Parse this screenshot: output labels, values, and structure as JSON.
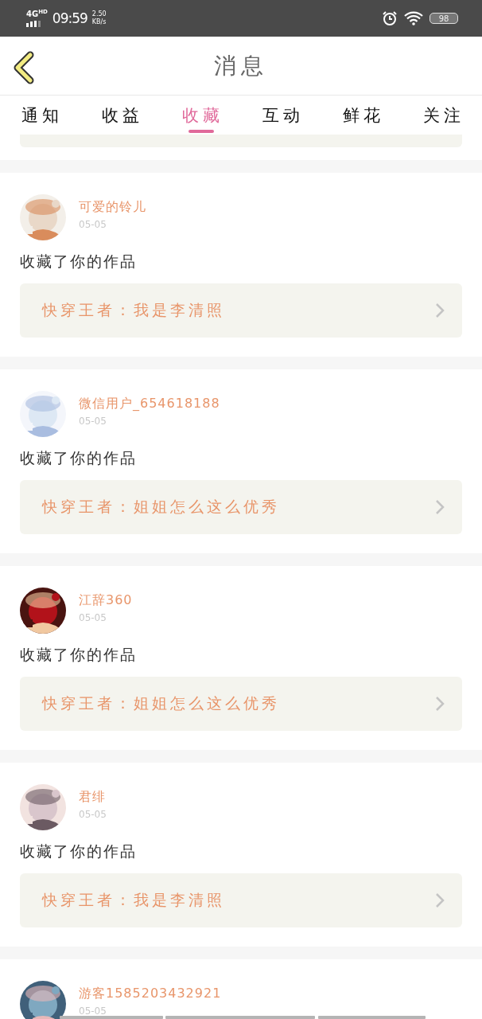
{
  "status_bar": {
    "network": "4G",
    "network_badge": "HD",
    "time": "09:59",
    "speed": "2.50",
    "speed_unit": "KB/s",
    "battery": "98"
  },
  "header": {
    "title": "消息"
  },
  "tabs": [
    {
      "label": "通知",
      "selected": false
    },
    {
      "label": "收益",
      "selected": false
    },
    {
      "label": "收藏",
      "selected": true
    },
    {
      "label": "互动",
      "selected": false
    },
    {
      "label": "鲜花",
      "selected": false
    },
    {
      "label": "关注",
      "selected": false
    }
  ],
  "messages": [
    {
      "user": "可爱的铃儿",
      "date": "05-05",
      "action": "收藏了你的作品",
      "work": "快穿王者：我是李清照"
    },
    {
      "user": "微信用户_654618188",
      "date": "05-05",
      "action": "收藏了你的作品",
      "work": "快穿王者：姐姐怎么这么优秀"
    },
    {
      "user": "江辞360",
      "date": "05-05",
      "action": "收藏了你的作品",
      "work": "快穿王者：姐姐怎么这么优秀"
    },
    {
      "user": "君绯",
      "date": "05-05",
      "action": "收藏了你的作品",
      "work": "快穿王者：我是李清照"
    },
    {
      "user": "游客1585203432921",
      "date": "05-05"
    }
  ]
}
